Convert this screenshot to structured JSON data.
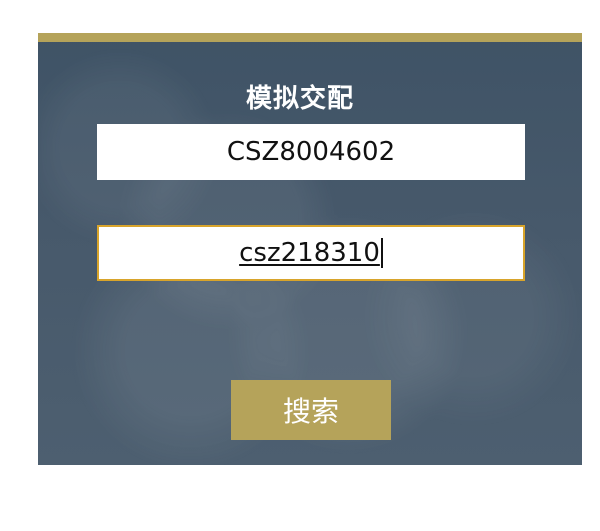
{
  "dialog": {
    "title": "模拟交配",
    "field_1_value": "CSZ8004602",
    "field_2_value": "csz218310",
    "search_label": "搜索"
  },
  "colors": {
    "accent": "#b5a35a",
    "panel_bg": "#47596b",
    "focus_border": "#d8a42b",
    "text": "#111111"
  }
}
